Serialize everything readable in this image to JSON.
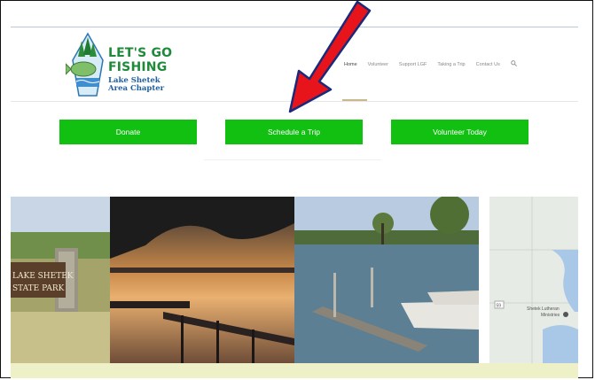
{
  "logo": {
    "title_line1": "LET'S GO",
    "title_line2": "FISHING",
    "subtitle_line1": "Lake Shetek",
    "subtitle_line2": "Area Chapter"
  },
  "nav": {
    "items": [
      "Home",
      "Volunteer",
      "Support LGF",
      "Taking a Trip",
      "Contact Us"
    ]
  },
  "buttons": {
    "donate": "Donate",
    "schedule": "Schedule a Trip",
    "volunteer": "Volunteer Today"
  },
  "photos": {
    "sign_line1": "LAKE SHETEK",
    "sign_line2": "STATE PARK"
  },
  "map": {
    "label_line1": "Shetek Lutheran",
    "label_line2": "Ministries",
    "route": "59"
  },
  "colors": {
    "button_green": "#12c012",
    "logo_green": "#1f8a3a",
    "logo_blue": "#1f5fa0",
    "arrow_red": "#e8141b",
    "arrow_outline": "#1a2a7a"
  }
}
